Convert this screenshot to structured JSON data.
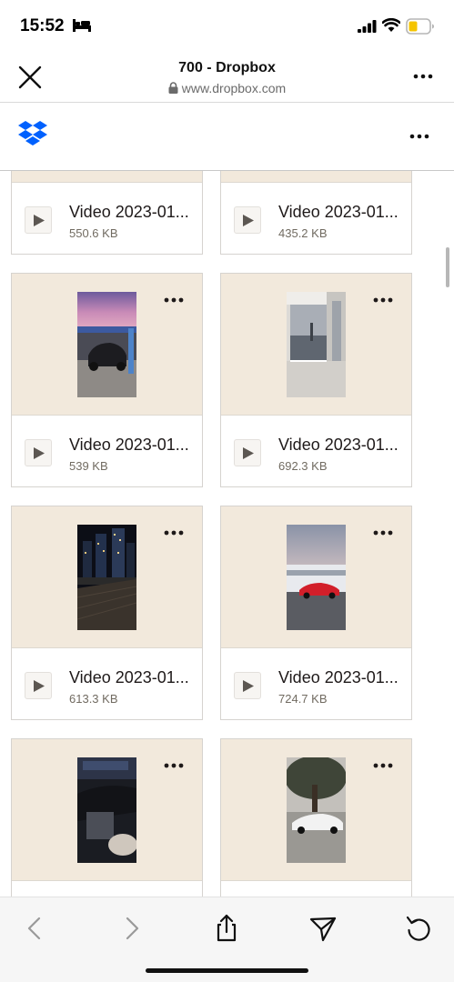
{
  "status": {
    "time": "15:52",
    "icons": [
      "bed-icon",
      "signal-icon",
      "wifi-icon",
      "battery-icon"
    ]
  },
  "browser": {
    "title": "700 - Dropbox",
    "url": "www.dropbox.com",
    "icons": [
      "close-icon",
      "lock-icon",
      "more-icon"
    ]
  },
  "dropbox": {
    "logo": "dropbox-logo",
    "accent": "#0061fe"
  },
  "files": [
    {
      "name": "Video 2023-01...",
      "size": "550.6 KB",
      "thumb": "railing"
    },
    {
      "name": "Video 2023-01...",
      "size": "435.2 KB",
      "thumb": "night-window"
    },
    {
      "name": "Video 2023-01...",
      "size": "539 KB",
      "thumb": "car-dusk"
    },
    {
      "name": "Video 2023-01...",
      "size": "692.3 KB",
      "thumb": "window-city"
    },
    {
      "name": "Video 2023-01...",
      "size": "613.3 KB",
      "thumb": "night-skyline"
    },
    {
      "name": "Video 2023-01...",
      "size": "724.7 KB",
      "thumb": "red-car"
    },
    {
      "name": "",
      "size": "",
      "thumb": "car-interior"
    },
    {
      "name": "",
      "size": "",
      "thumb": "white-car-tree"
    }
  ],
  "toolbar": {
    "icons": [
      "back-icon",
      "forward-icon",
      "share-icon",
      "send-icon",
      "reload-icon"
    ]
  },
  "colors": {
    "thumb_bg": "#f2e9dc",
    "text": "#1e1919",
    "muted": "#716b61"
  }
}
